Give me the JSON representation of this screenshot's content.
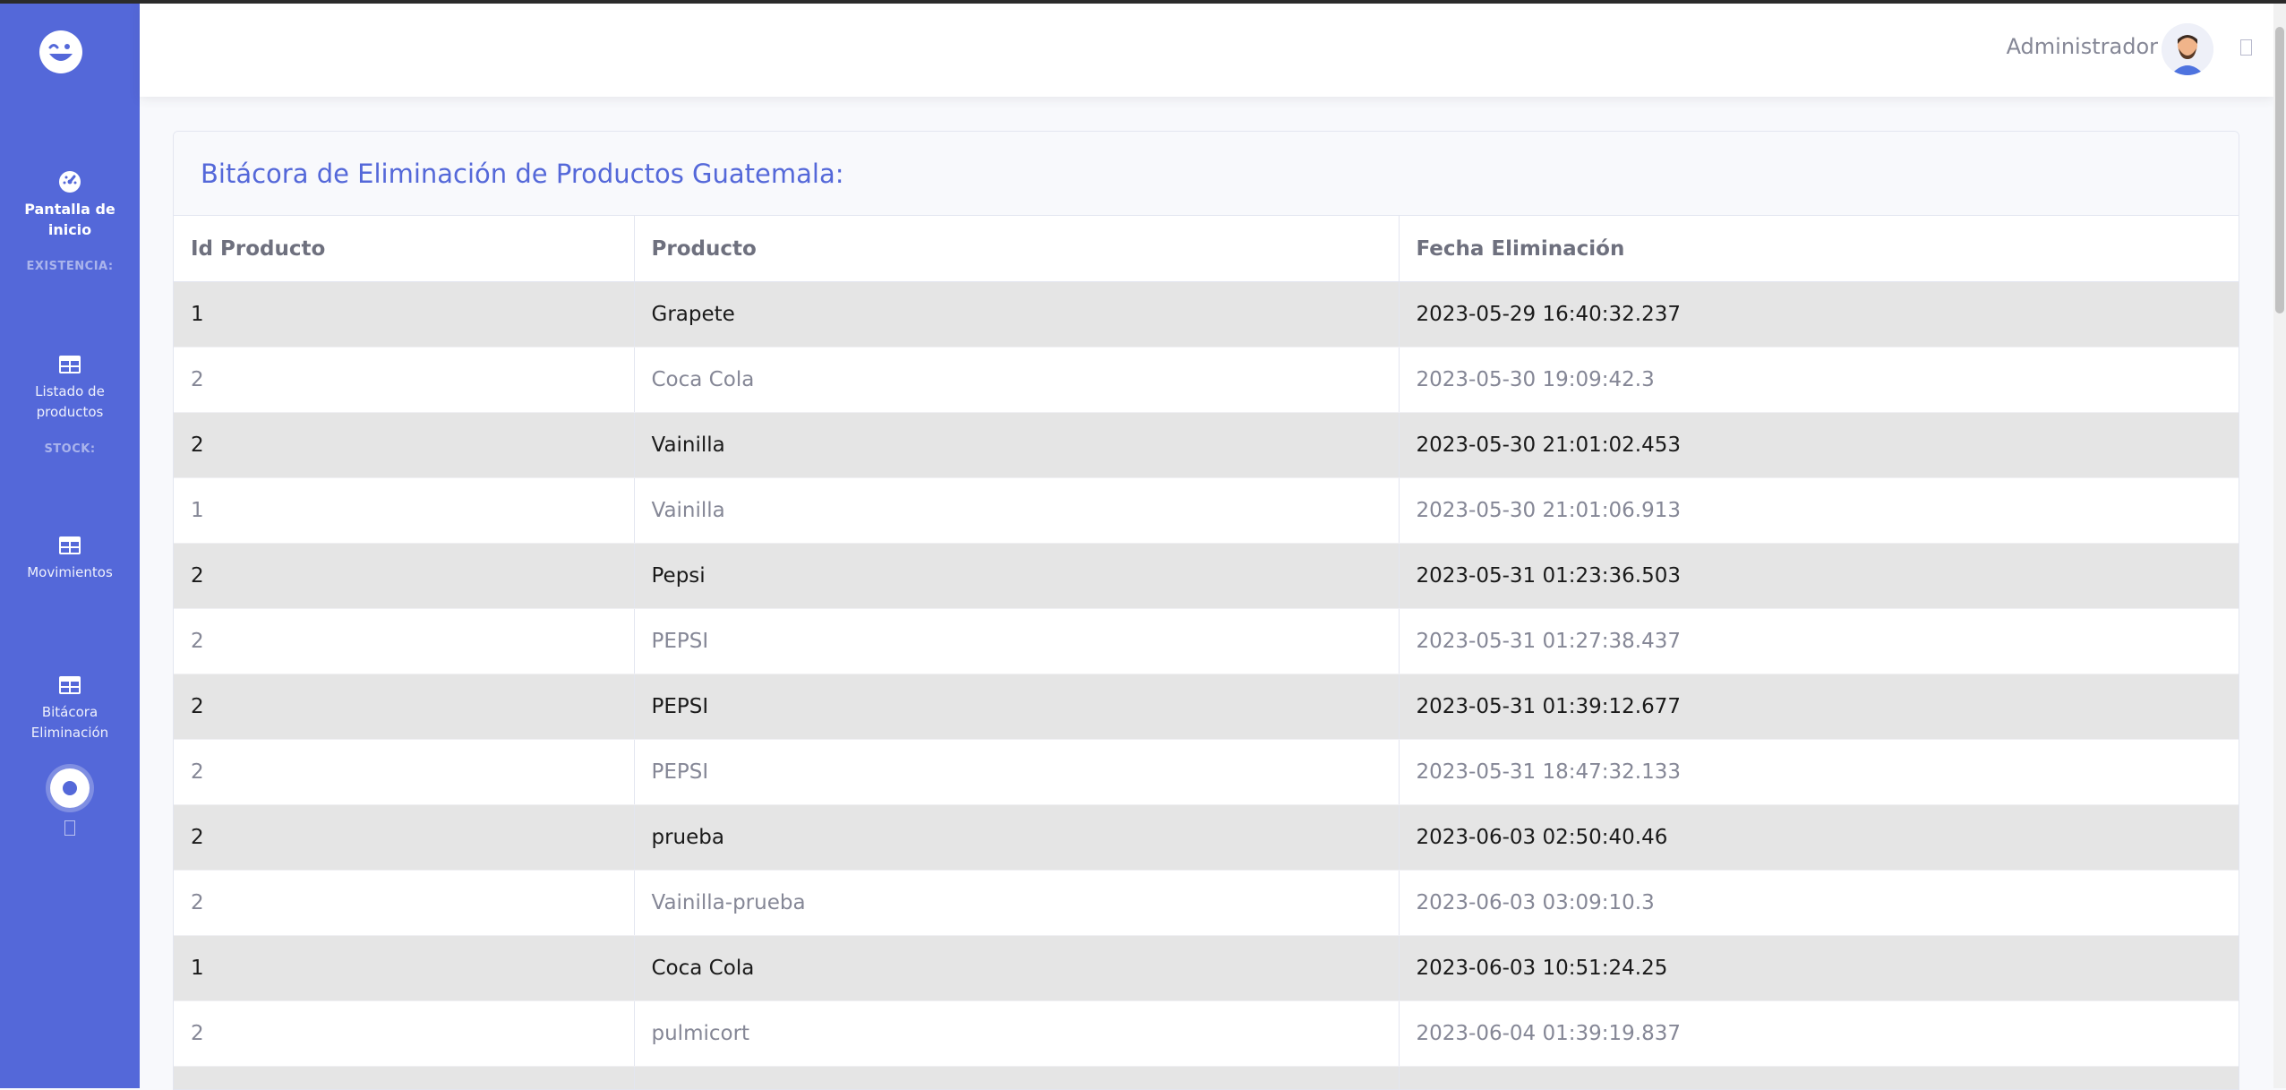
{
  "sidebar": {
    "nav": [
      {
        "label_line1": "Pantalla de",
        "label_line2": "inicio"
      },
      {
        "label_line1": "Listado de",
        "label_line2": "productos"
      },
      {
        "label_line1": "Movimientos",
        "label_line2": ""
      },
      {
        "label_line1": "Bitácora",
        "label_line2": "Eliminación"
      }
    ],
    "headings": [
      "EXISTENCIA:",
      "STOCK:"
    ]
  },
  "topbar": {
    "user_name": "Administrador"
  },
  "card": {
    "title": "Bitácora de Eliminación de Productos Guatemala:",
    "columns": [
      "Id Producto",
      "Producto",
      "Fecha Eliminación"
    ],
    "rows": [
      [
        "1",
        "Grapete",
        "2023-05-29 16:40:32.237"
      ],
      [
        "2",
        "Coca Cola",
        "2023-05-30 19:09:42.3"
      ],
      [
        "2",
        "Vainilla",
        "2023-05-30 21:01:02.453"
      ],
      [
        "1",
        "Vainilla",
        "2023-05-30 21:01:06.913"
      ],
      [
        "2",
        "Pepsi",
        "2023-05-31 01:23:36.503"
      ],
      [
        "2",
        "PEPSI",
        "2023-05-31 01:27:38.437"
      ],
      [
        "2",
        "PEPSI",
        "2023-05-31 01:39:12.677"
      ],
      [
        "2",
        "PEPSI",
        "2023-05-31 18:47:32.133"
      ],
      [
        "2",
        "prueba",
        "2023-06-03 02:50:40.46"
      ],
      [
        "2",
        "Vainilla-prueba",
        "2023-06-03 03:09:10.3"
      ],
      [
        "1",
        "Coca Cola",
        "2023-06-03 10:51:24.25"
      ],
      [
        "2",
        "pulmicort",
        "2023-06-04 01:39:19.837"
      ],
      [
        "",
        "",
        ""
      ]
    ]
  },
  "colors": {
    "primary": "#5468d9",
    "text_muted": "#858796",
    "row_stripe": "#e5e5e5"
  },
  "icons": [
    "laugh-wink-icon",
    "tachometer-icon",
    "table-icon",
    "user-avatar-icon"
  ]
}
